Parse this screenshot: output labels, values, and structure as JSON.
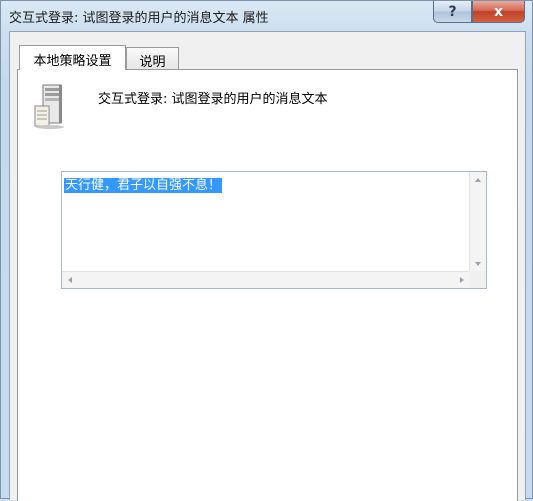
{
  "window": {
    "title": "交互式登录: 试图登录的用户的消息文本 属性",
    "help_button": "?",
    "close_button": "x"
  },
  "tabs": [
    {
      "label": "本地策略设置",
      "active": true
    },
    {
      "label": "说明",
      "active": false
    }
  ],
  "policy": {
    "icon": "server-icon",
    "title": "交互式登录: 试图登录的用户的消息文本"
  },
  "message_text": {
    "value": "天行健，君子以自强不息！",
    "selected": true
  },
  "colors": {
    "selection": "#3399ff",
    "close_button": "#c0412a"
  }
}
